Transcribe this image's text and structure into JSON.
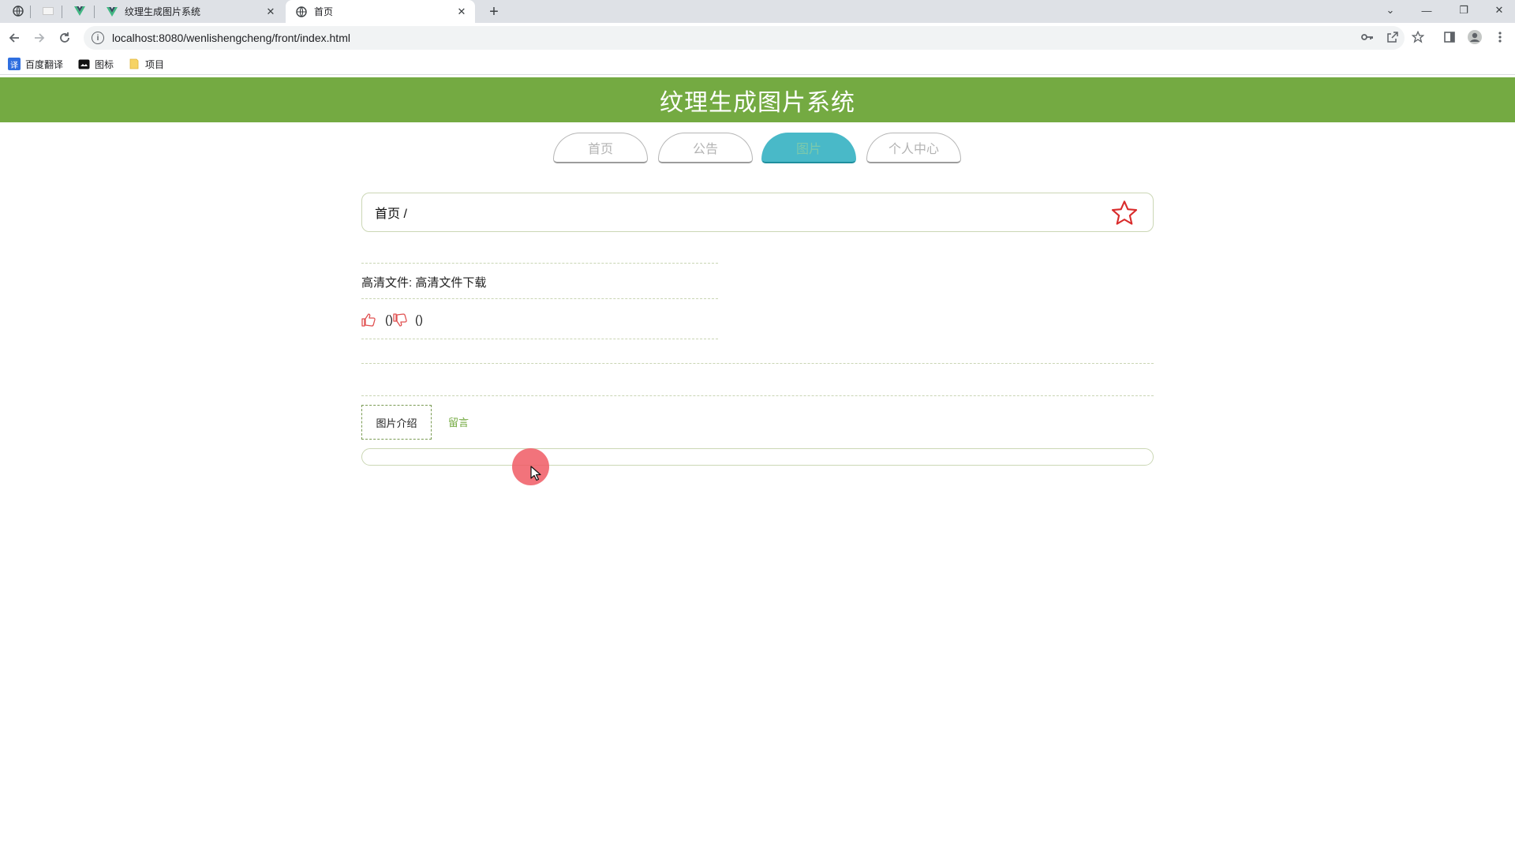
{
  "browser": {
    "tabs": [
      {
        "title": "纹理生成图片系统",
        "close": "✕"
      },
      {
        "title": "首页",
        "close": "✕"
      }
    ],
    "new_tab": "+",
    "window_controls": {
      "dropdown": "⌄",
      "minimize": "—",
      "restore": "❐",
      "close": "✕"
    },
    "url": "localhost:8080/wenlishengcheng/front/index.html",
    "bookmarks": [
      {
        "label": "百度翻译",
        "icon": "translate-icon"
      },
      {
        "label": "图标",
        "icon": "image-icon"
      },
      {
        "label": "项目",
        "icon": "folder-icon"
      }
    ]
  },
  "page": {
    "site_title": "纹理生成图片系统",
    "nav": [
      {
        "label": "首页"
      },
      {
        "label": "公告"
      },
      {
        "label": "图片",
        "active": true
      },
      {
        "label": "个人中心"
      }
    ],
    "breadcrumb": "首页 /",
    "file_label": "高清文件:",
    "file_link": "高清文件下载",
    "likes": "()",
    "dislikes": "()",
    "tabs": [
      {
        "label": "图片介绍",
        "active": true
      },
      {
        "label": "留言"
      }
    ]
  },
  "colors": {
    "header_green": "#74aa42",
    "active_nav": "#49b9c8",
    "star_red": "#d92b2b",
    "thumb_red": "#e05050"
  }
}
